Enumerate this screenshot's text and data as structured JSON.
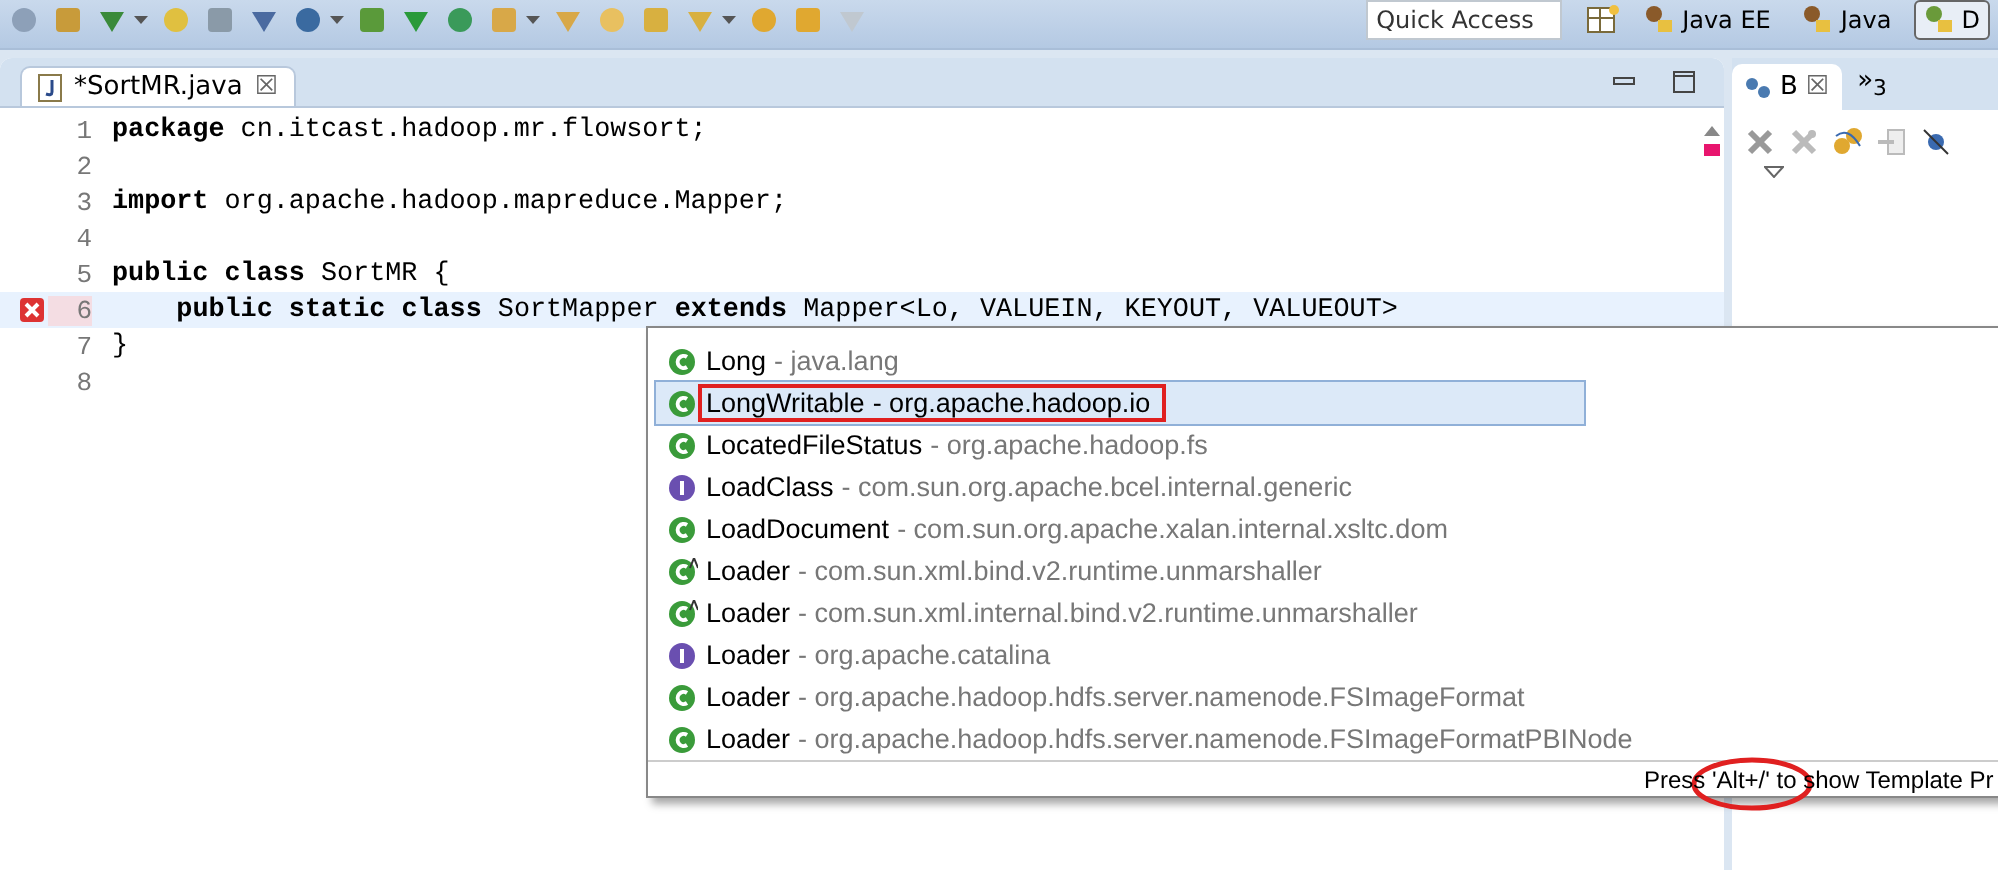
{
  "toolbar": {
    "quick_access": {
      "placeholder": "Quick Access"
    },
    "perspectives": [
      {
        "label": "Java EE",
        "selected": false
      },
      {
        "label": "Java",
        "selected": false
      },
      {
        "label": "D",
        "selected": true
      }
    ]
  },
  "editor": {
    "tab": {
      "title": "*SortMR.java",
      "close": "☒"
    },
    "lines": [
      {
        "number": "1",
        "code": "**package** cn.itcast.hadoop.mr.flowsort;",
        "current": false,
        "error": false
      },
      {
        "number": "2",
        "current": false,
        "error": false
      },
      {
        "number": "3",
        "code": "**import** org.apache.hadoop.mapreduce.Mapper;",
        "current": false,
        "error": false
      },
      {
        "number": "4",
        "current": false,
        "error": false
      },
      {
        "number": "5",
        "code": "**public** **class** SortMR {",
        "current": false,
        "error": false
      },
      {
        "number": "6",
        "code": "    **public** **static** **class** SortMapper **extends** Mapper<Lo, VALUEIN, KEYOUT, VALUEOUT>",
        "current": true,
        "error": true
      },
      {
        "number": "7",
        "code": "}",
        "current": false,
        "error": false
      },
      {
        "number": "8",
        "current": false,
        "error": false
      }
    ]
  },
  "side_panel": {
    "tab": {
      "title": "B",
      "close": "☒"
    },
    "overflow": {
      "symbol": "»",
      "count": "3"
    }
  },
  "completion_popup": {
    "items": [
      {
        "kind": "class",
        "name": "Long",
        "qualifier": "- java.lang",
        "selected": false
      },
      {
        "kind": "class",
        "name": "LongWritable",
        "qualifier": "- org.apache.hadoop.io",
        "selected": true
      },
      {
        "kind": "class",
        "name": "LocatedFileStatus",
        "qualifier": "- org.apache.hadoop.fs",
        "selected": false
      },
      {
        "kind": "interface",
        "name": "LoadClass",
        "qualifier": "- com.sun.org.apache.bcel.internal.generic",
        "selected": false
      },
      {
        "kind": "class",
        "name": "LoadDocument",
        "qualifier": "- com.sun.org.apache.xalan.internal.xsltc.dom",
        "selected": false
      },
      {
        "kind": "abstract-class",
        "name": "Loader",
        "qualifier": "- com.sun.xml.bind.v2.runtime.unmarshaller",
        "selected": false
      },
      {
        "kind": "abstract-class",
        "name": "Loader",
        "qualifier": "- com.sun.xml.internal.bind.v2.runtime.unmarshaller",
        "selected": false
      },
      {
        "kind": "interface",
        "name": "Loader",
        "qualifier": "- org.apache.catalina",
        "selected": false
      },
      {
        "kind": "class",
        "name": "Loader",
        "qualifier": "- org.apache.hadoop.hdfs.server.namenode.FSImageFormat",
        "selected": false
      },
      {
        "kind": "class",
        "name": "Loader",
        "qualifier": "- org.apache.hadoop.hdfs.server.namenode.FSImageFormatPBINode",
        "selected": false
      }
    ],
    "footer": "Press 'Alt+/' to show Template Pr"
  }
}
